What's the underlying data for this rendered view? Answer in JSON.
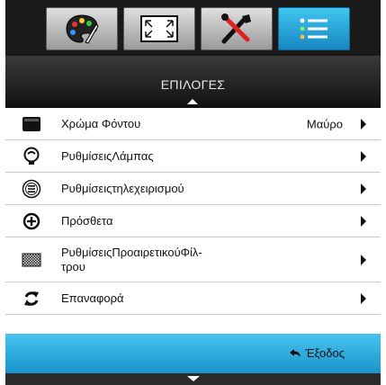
{
  "tabs": [
    {
      "icon": "palette-icon",
      "active": false
    },
    {
      "icon": "screen-expand-icon",
      "active": false
    },
    {
      "icon": "tools-icon",
      "active": false
    },
    {
      "icon": "list-menu-icon",
      "active": true
    }
  ],
  "header": {
    "title": "ΕΠΙΛΟΓΕΣ"
  },
  "menu_items": [
    {
      "icon": "monitor-icon",
      "label": "Χρώμα Φόντου",
      "value": "Μαύρο",
      "has_arrow": true
    },
    {
      "icon": "lamp-icon",
      "label": "ΡυθμίσειςΛάμπας",
      "value": "",
      "has_arrow": true
    },
    {
      "icon": "remote-icon",
      "label": "Ρυθμίσειςτηλεχειρισμού",
      "value": "",
      "has_arrow": true
    },
    {
      "icon": "plus-circle-icon",
      "label": "Πρόσθετα",
      "value": "",
      "has_arrow": true
    },
    {
      "icon": "filter-icon",
      "label": "ΡυθμίσειςΠροαιρετικούΦίλ-τρου",
      "label_line1": "ΡυθμίσειςΠροαιρετικούΦίλ-",
      "label_line2": "τρου",
      "value": "",
      "has_arrow": true
    },
    {
      "icon": "reset-icon",
      "label": "Επαναφορά",
      "value": "",
      "has_arrow": true
    }
  ],
  "footer": {
    "exit_label": "Έξοδος",
    "exit_icon": "back-arrow-icon"
  },
  "colors": {
    "accent": "#2aa6e0",
    "background": "#1f1f1f",
    "menu_bg": "#ffffff"
  }
}
